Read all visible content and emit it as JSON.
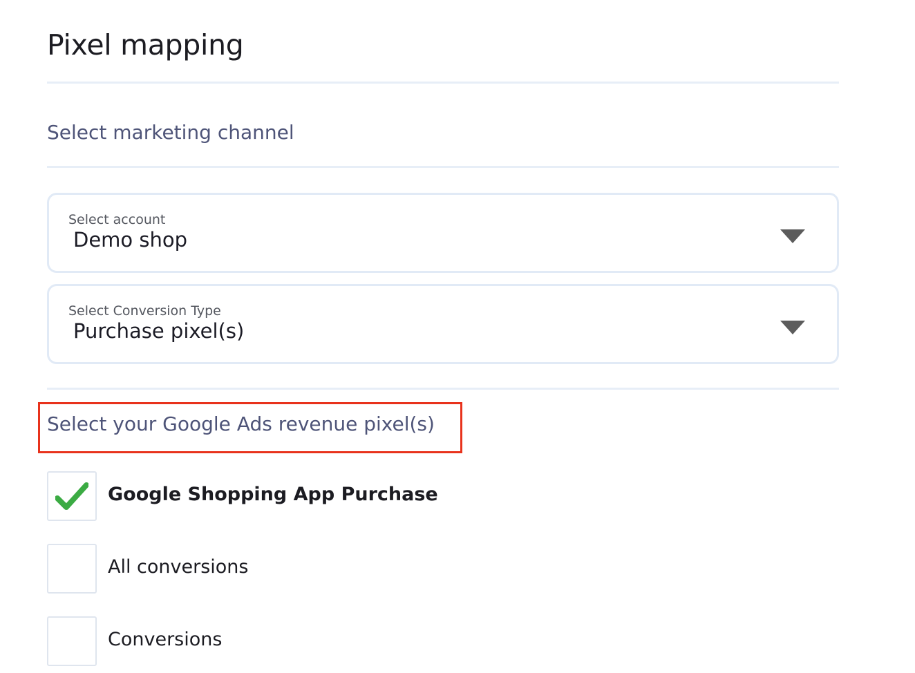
{
  "page": {
    "title": "Pixel mapping"
  },
  "channel_section": {
    "heading": "Select marketing channel"
  },
  "account_select": {
    "label": "Select account",
    "value": "Demo shop",
    "icon": "dropdown-caret-icon"
  },
  "conversion_type_select": {
    "label": "Select Conversion Type",
    "value": "Purchase pixel(s)",
    "icon": "dropdown-caret-icon"
  },
  "revenue_pixel_section": {
    "heading": "Select your Google Ads revenue pixel(s)",
    "highlight_color": "#e8321c",
    "items": [
      {
        "label": "Google Shopping App Purchase",
        "checked": true
      },
      {
        "label": "All conversions",
        "checked": false
      },
      {
        "label": "Conversions",
        "checked": false
      }
    ]
  },
  "colors": {
    "check_green": "#3bab43",
    "heading_text": "#4e5478",
    "divider": "#e7eef7",
    "select_border": "#e1eaf6"
  }
}
